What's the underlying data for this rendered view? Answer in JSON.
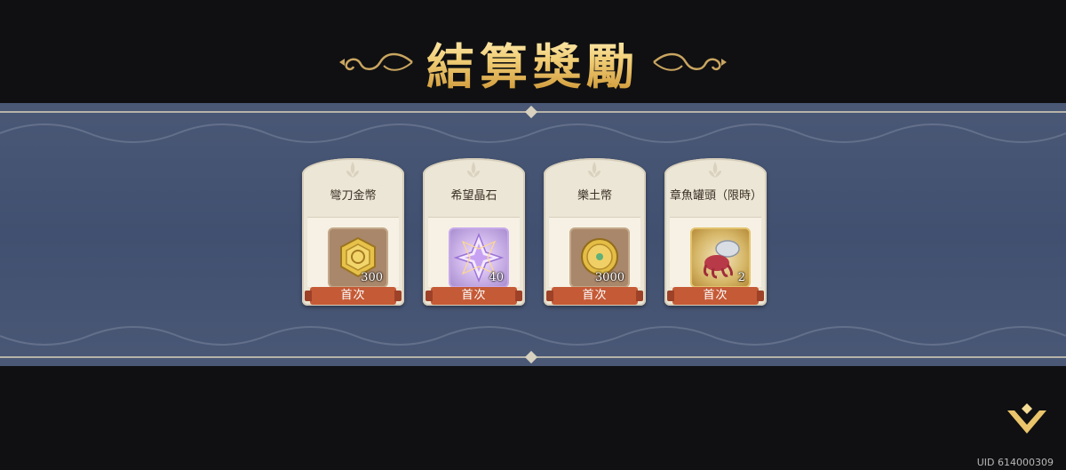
{
  "title": "結算獎勵",
  "rewards": [
    {
      "name": "彎刀金幣",
      "quantity": "300",
      "tag": "首次",
      "icon": "hex-gold-coin-icon",
      "style": "bronze"
    },
    {
      "name": "希望晶石",
      "quantity": "40",
      "tag": "首次",
      "icon": "crystal-star-icon",
      "style": "purple"
    },
    {
      "name": "樂土幣",
      "quantity": "3000",
      "tag": "首次",
      "icon": "round-gold-coin-icon",
      "style": "bronze"
    },
    {
      "name": "章魚罐頭（限時）",
      "quantity": "2",
      "tag": "首次",
      "icon": "octopus-can-icon",
      "style": "gold"
    }
  ],
  "uid": "UID 614000309",
  "colors": {
    "gold": "#f2cf78",
    "band": "#445272",
    "ribbon": "#c55a36",
    "card": "#ece6d6"
  }
}
